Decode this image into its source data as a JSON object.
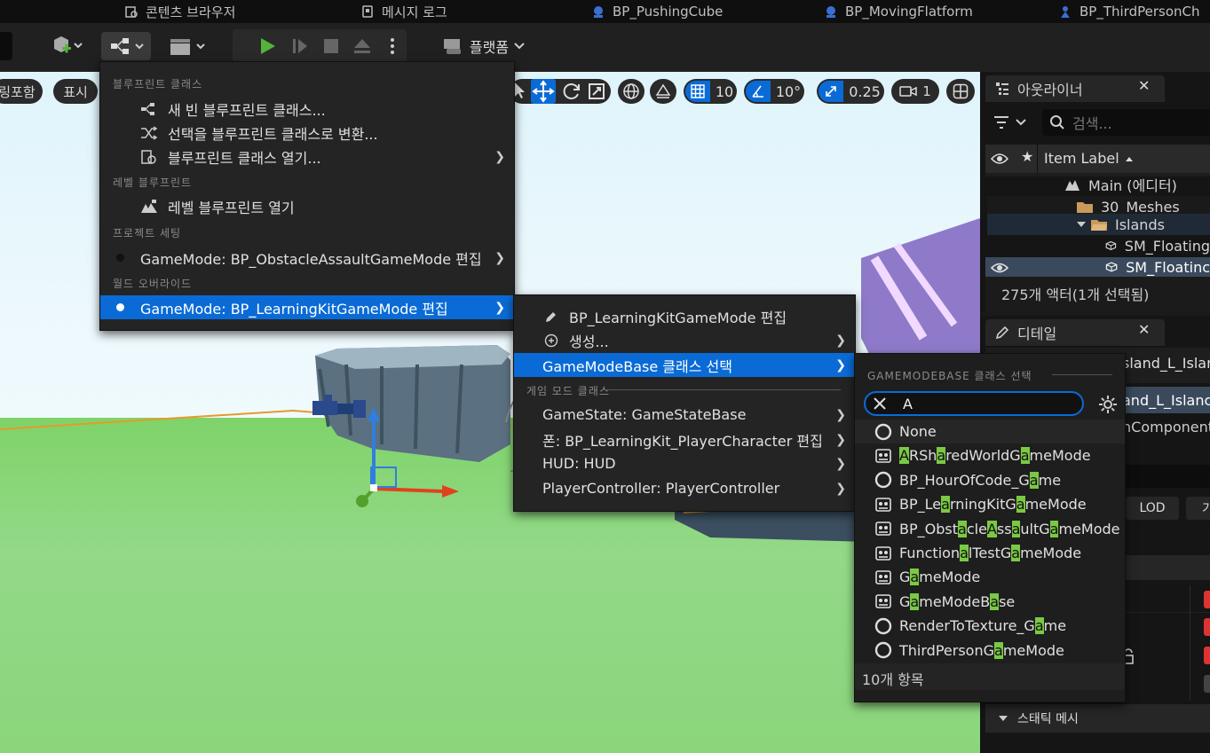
{
  "tabs": [
    {
      "label": "콘텐츠 브라우저",
      "icon": "content-browser-icon"
    },
    {
      "label": "메시지 로그",
      "icon": "message-log-icon"
    },
    {
      "label": "BP_PushingCube",
      "icon": "blueprint-icon"
    },
    {
      "label": "BP_MovingFlatform",
      "icon": "blueprint-icon"
    },
    {
      "label": "BP_ThirdPersonCh",
      "icon": "blueprint-icon"
    }
  ],
  "toolbar": {
    "platform_label": "플랫폼"
  },
  "viewport": {
    "chip_left": "링포함",
    "chip_show": "표시",
    "grid_snap": "10",
    "rotation_snap": "10°",
    "scale_snap": "0.25",
    "camera_speed": "1"
  },
  "outliner": {
    "title": "아웃라이너",
    "search_placeholder": "검색...",
    "column_label": "Item Label",
    "rows": [
      {
        "label": "Main (에디터)"
      },
      {
        "label": "30_Meshes"
      },
      {
        "label": "Islands"
      },
      {
        "label": "SM_Floating"
      },
      {
        "label": "SM_Floatinc"
      }
    ],
    "status": "275개 액터(1개 선택됨)"
  },
  "details": {
    "title": "디테일",
    "name1": "sland_L_Islar",
    "name2": "and_L_Islanc",
    "component": "nComponent",
    "lod_button": "LOD",
    "other_button": "기",
    "static_mesh_section": "스태틱 메시"
  },
  "blueprint_menu": {
    "section_blueprint_class": "블루프린트 클래스",
    "new_empty_bp": "새 빈 블루프린트 클래스...",
    "convert_selection": "선택을 블루프린트 클래스로 변환...",
    "open_bp_class": "블루프린트 클래스 열기...",
    "section_level_bp": "레벨 블루프린트",
    "open_level_bp": "레벨 블루프린트 열기",
    "section_project_settings": "프로젝트 세팅",
    "project_gamemode": "GameMode: BP_ObstacleAssaultGameMode 편집",
    "section_world_override": "월드 오버라이드",
    "world_gamemode": "GameMode: BP_LearningKitGameMode 편집"
  },
  "gamemode_submenu": {
    "edit": "BP_LearningKitGameMode 편집",
    "create": "생성...",
    "select_base": "GameModeBase 클래스 선택",
    "section_game_mode_classes": "게임 모드 클래스",
    "game_state": "GameState: GameStateBase",
    "pawn": "폰: BP_LearningKit_PlayerCharacter 편집",
    "hud": "HUD: HUD",
    "player_controller": "PlayerController: PlayerController"
  },
  "class_picker": {
    "header": "GAMEMODEBASE 클래스 선택",
    "search_value": "A",
    "items": [
      {
        "name": "None",
        "icon": "circle-icon"
      },
      {
        "name": "ARSharedWorldGameMode",
        "icon": "gamemode-icon"
      },
      {
        "name": "BP_HourOfCode_Game",
        "icon": "circle-icon"
      },
      {
        "name": "BP_LearningKitGameMode",
        "icon": "gamemode-icon"
      },
      {
        "name": "BP_ObstacleAssaultGameMode",
        "icon": "gamemode-icon"
      },
      {
        "name": "FunctionalTestGameMode",
        "icon": "gamemode-icon"
      },
      {
        "name": "GameMode",
        "icon": "gamemode-icon"
      },
      {
        "name": "GameModeBase",
        "icon": "gamemode-icon"
      },
      {
        "name": "RenderToTexture_Game",
        "icon": "circle-icon"
      },
      {
        "name": "ThirdPersonGameMode",
        "icon": "circle-icon"
      }
    ],
    "count": "10개 항목"
  },
  "colors": {
    "selection": "#0a6bd6",
    "highlight": "#7ac943",
    "play_green": "#55b33a"
  }
}
